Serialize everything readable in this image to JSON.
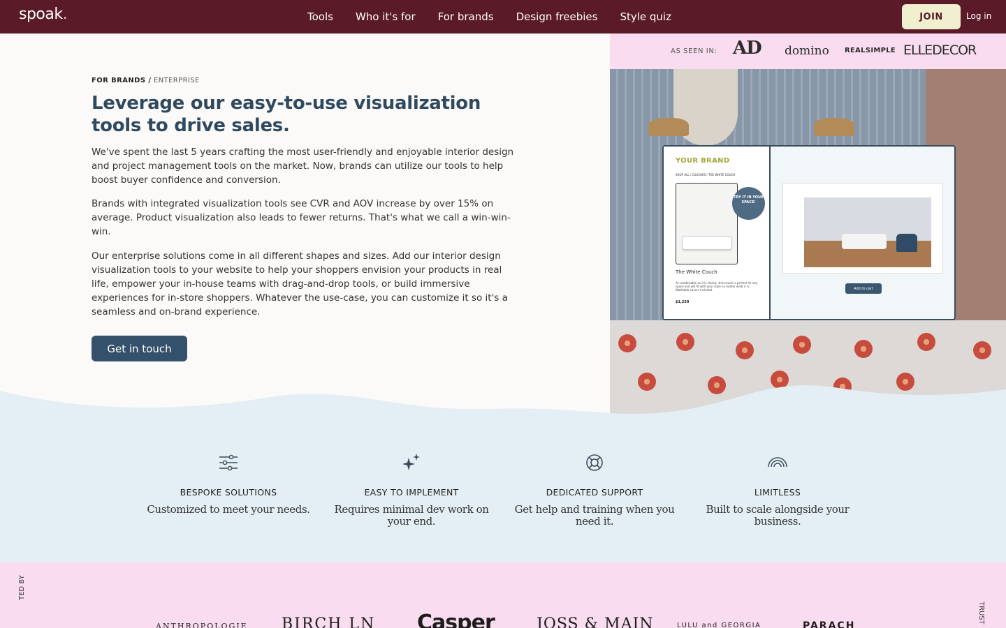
{
  "nav": {
    "logo": "spoak",
    "logo_dot": ".",
    "links": [
      "Tools",
      "Who it's for",
      "For brands",
      "Design freebies",
      "Style quiz"
    ],
    "join": "JOIN",
    "login": "Log in",
    "bg_color": "#5b1a27"
  },
  "seen": {
    "label": "AS SEEN IN:",
    "publications": [
      "AD",
      "domino",
      "REALSIMPLE",
      "ELLEDECOR"
    ]
  },
  "hero": {
    "breadcrumb_strong": "FOR BRANDS /",
    "breadcrumb_light": "ENTERPRISE",
    "headline": "Leverage our easy-to-use visualization tools to drive sales.",
    "paragraphs": [
      "We've spent the last 5 years crafting the most user-friendly and enjoyable interior design and project management tools on the market. Now, brands can utilize our tools to help boost buyer confidence and conversion.",
      "Brands with integrated visualization tools see CVR and AOV increase by over 15% on average. Product visualization also leads to fewer returns. That's what we call a win-win-win.",
      "Our enterprise solutions come in all different shapes and sizes. Add our interior design visualization tools to your website to help your shoppers envision your products in real life, empower your in-house teams with drag-and-drop tools, or build immersive experiences for in-store shoppers. Whatever the use-case, you can customize it so it's a seamless and on-brand experience."
    ],
    "cta": "Get in touch",
    "accent_color": "#2f4a60"
  },
  "mockup": {
    "brand": "YOUR BRAND",
    "crumb": "SHOP ALL / COUCHES / THE WHITE COUCH",
    "badge": "TRY IT IN YOUR SPACE!",
    "product_name": "The White Couch",
    "product_desc": "As comfortable as it is classic, this couch is perfect for any space and will fit with your style no matter what it is. Washable covers included.",
    "price": "$1,250",
    "add_to_cart": "Add to cart"
  },
  "features": [
    {
      "icon": "sliders-icon",
      "title": "BESPOKE SOLUTIONS",
      "desc": "Customized to meet your needs."
    },
    {
      "icon": "sparkles-icon",
      "title": "EASY TO IMPLEMENT",
      "desc": "Requires minimal dev work on your end."
    },
    {
      "icon": "lifebuoy-icon",
      "title": "DEDICATED SUPPORT",
      "desc": "Get help and training when you need it."
    },
    {
      "icon": "rainbow-icon",
      "title": "LIMITLESS",
      "desc": "Built to scale alongside your business."
    }
  ],
  "trusted": {
    "left_label": "TED BY",
    "right_label": "TRUST",
    "brands": [
      "ANTHROPOLOGIE",
      "BIRCH LN",
      "Casper",
      "JOSS & MAIN",
      "LULU and GEORGIA",
      "PARACH"
    ]
  },
  "colors": {
    "features_bg": "#e4eff5",
    "pink_bg": "#f9dcef",
    "join_bg": "#f0efcf"
  }
}
